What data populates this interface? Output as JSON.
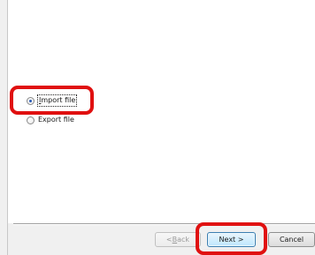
{
  "options": {
    "import_label_prefix": "",
    "import_label_mnemonic": "I",
    "import_label_rest": "mport file",
    "export_label": "Export file",
    "selected": "import"
  },
  "buttons": {
    "back_prefix": "< ",
    "back_mnemonic": "B",
    "back_rest": "ack",
    "next_label": "Next >",
    "cancel_label": "Cancel"
  },
  "annotations": {
    "highlight_color": "#e01010"
  },
  "colors": {
    "window_background": "#f0f0f0",
    "content_background": "#ffffff",
    "default_button_border": "#3c7fb1"
  }
}
